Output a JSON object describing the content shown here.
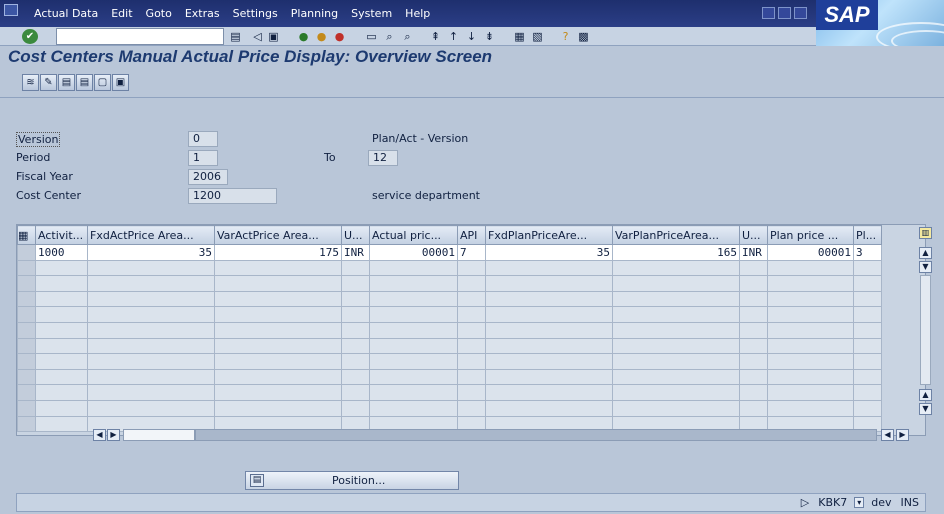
{
  "menu": [
    "Actual Data",
    "Edit",
    "Goto",
    "Extras",
    "Settings",
    "Planning",
    "System",
    "Help"
  ],
  "logo_text": "SAP",
  "command_field": {
    "value": ""
  },
  "screen_title": "Cost Centers Manual Actual Price Display: Overview Screen",
  "fields": {
    "version_label": "Version",
    "version_value": "0",
    "version_desc": "Plan/Act - Version",
    "period_label": "Period",
    "period_value": "1",
    "to_label": "To",
    "to_value": "12",
    "fiscal_year_label": "Fiscal Year",
    "fiscal_year_value": "2006",
    "cost_center_label": "Cost Center",
    "cost_center_value": "1200",
    "cost_center_desc": "service department"
  },
  "table": {
    "columns": [
      "Activit...",
      "FxdActPrice Area...",
      "VarActPrice Area...",
      "U...",
      "Actual pric...",
      "API",
      "FxdPlanPriceAre...",
      "VarPlanPriceArea...",
      "U...",
      "Plan price ...",
      "Pl..."
    ],
    "rows": [
      [
        "1000",
        "35",
        "175",
        "INR",
        "00001",
        "7",
        "35",
        "165",
        "INR",
        "00001",
        "3"
      ]
    ]
  },
  "position_button": "Position...",
  "status": {
    "transaction": "KBK7",
    "client": "dev",
    "mode": "INS"
  },
  "colors": {
    "menubar": "#1e2f6e",
    "background": "#b9c6d8",
    "title": "#1d3a70"
  }
}
